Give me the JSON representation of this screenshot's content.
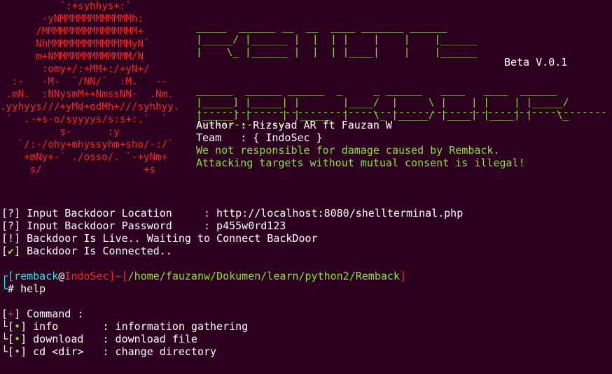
{
  "skull_art": "          `:+syhhys+:`\n       -yNMMMMMMMMMMMMh:\n      /MMMMMMMMMMMMMMMM+\n      NhMMMMMMMMMMMMMMyN`\n      m+NMMMMMMMMMMMMM/N\n       :omy+/:+MM+:/+yN+/\n  :-   -M-  `/NN/`  :M.   --\n .mN.  :NNysmM++NmssNN-  .Nm.\n.yyhyys///+yMd+odMh+///syhhyy.\n `  .-+s-o/syyyys/s:s+:.`  `\n          s-      :y\n   `/:-/ohy+mhyssyhm+sho/-:/`\n    +mNy+-` ./osso/. `-+yNm+\n     s/                 +s",
  "banner_art": "_____  ______ __  __  ____ _______ ______\n|_____/ |______ |  |  | |    |    |    |______\n|    \\_ |______ |  |  | |____|    |    |______\n\n\n______  ______ ______  _     _ ______   ____   ____  ______\n|_____] |_____| |       |____/  |     \\ |    | |    | |_____/\n|_____] |     | |_____  |    \\_ |_____/ |____| |____| |    \\_",
  "version": "Beta V.0.1",
  "separator": "-------------------------------------------------------------------------------",
  "info_lines": [
    {
      "label": "Author : ",
      "value": "Rizsyad AR ft Fauzan W"
    },
    {
      "label": "Team   : ",
      "value": "{ IndoSec }"
    }
  ],
  "disclaimer": [
    "We not responsible for damage caused by Remback.",
    "Attacking targets without mutual consent is illegal!"
  ],
  "output_lines": [
    {
      "mark": "?",
      "text": "Input Backdoor Location     : http://localhost:8080/shellterminal.php"
    },
    {
      "mark": "?",
      "text": "Input Backdoor Password     : p455w0rd123"
    },
    {
      "mark": "!",
      "text": "Backdoor Is Live.. Waiting to Connect BackDoor"
    },
    {
      "mark": "✔",
      "text": "Backdoor Is Connected.."
    }
  ],
  "prompt": {
    "user": "remback",
    "at": "@",
    "host": "IndoSec",
    "path": "/home/fauzanw/Dokumen/learn/python2/Remback",
    "symbol": "#",
    "command": "help"
  },
  "command_header": "Command :",
  "commands": [
    {
      "name": "info      ",
      "desc": ": information gathering"
    },
    {
      "name": "download  ",
      "desc": ": download file"
    },
    {
      "name": "cd <dir>  ",
      "desc": ": change directory"
    }
  ],
  "colors": {
    "background": "#2c001e",
    "red": "#ef2929",
    "green": "#8ae234",
    "cyan": "#34e2e2"
  }
}
